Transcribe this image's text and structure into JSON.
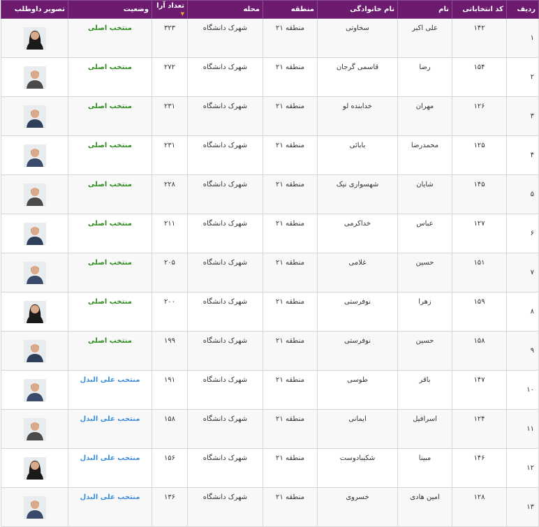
{
  "headers": {
    "row": "ردیف",
    "code": "کد انتخاباتی",
    "name": "نام",
    "family": "نام خانوادگی",
    "region": "منطقه",
    "area": "محله",
    "votes": "تعداد آرا",
    "status": "وضعیت",
    "photo": "تصویر داوطلب"
  },
  "colors": {
    "header_bg": "#6c1b6f",
    "status_main": "#2e8b1f",
    "status_alt": "#3b8fd8",
    "sort_icon": "#f0a33a"
  },
  "rows": [
    {
      "row": "۱",
      "code": "۱۴۲",
      "name": "علی اکبر",
      "family": "سخاوتی",
      "region": "منطقه ۲۱",
      "area": "شهرک دانشگاه",
      "votes": "۳۲۳",
      "status": "منتخب اصلی",
      "status_type": "main",
      "photo": "female-avatar-icon"
    },
    {
      "row": "۲",
      "code": "۱۵۴",
      "name": "رضا",
      "family": "قاسمی گرجان",
      "region": "منطقه ۲۱",
      "area": "شهرک دانشگاه",
      "votes": "۲۷۲",
      "status": "منتخب اصلی",
      "status_type": "main",
      "photo": "male-avatar-icon"
    },
    {
      "row": "۳",
      "code": "۱۲۶",
      "name": "مهران",
      "family": "خدابنده لو",
      "region": "منطقه ۲۱",
      "area": "شهرک دانشگاه",
      "votes": "۲۳۱",
      "status": "منتخب اصلی",
      "status_type": "main",
      "photo": "male-avatar-icon"
    },
    {
      "row": "۴",
      "code": "۱۲۵",
      "name": "محمدرضا",
      "family": "بابائی",
      "region": "منطقه ۲۱",
      "area": "شهرک دانشگاه",
      "votes": "۲۳۱",
      "status": "منتخب اصلی",
      "status_type": "main",
      "photo": "male-avatar-icon"
    },
    {
      "row": "۵",
      "code": "۱۴۵",
      "name": "شایان",
      "family": "شهسواری نیک",
      "region": "منطقه ۲۱",
      "area": "شهرک دانشگاه",
      "votes": "۲۲۸",
      "status": "منتخب اصلی",
      "status_type": "main",
      "photo": "male-avatar-icon"
    },
    {
      "row": "۶",
      "code": "۱۲۷",
      "name": "عباس",
      "family": "خداکرمی",
      "region": "منطقه ۲۱",
      "area": "شهرک دانشگاه",
      "votes": "۲۱۱",
      "status": "منتخب اصلی",
      "status_type": "main",
      "photo": "male-avatar-icon"
    },
    {
      "row": "۷",
      "code": "۱۵۱",
      "name": "حسین",
      "family": "غلامی",
      "region": "منطقه ۲۱",
      "area": "شهرک دانشگاه",
      "votes": "۲۰۵",
      "status": "منتخب اصلی",
      "status_type": "main",
      "photo": "male-avatar-icon"
    },
    {
      "row": "۸",
      "code": "۱۵۹",
      "name": "زهرا",
      "family": "نوفرستی",
      "region": "منطقه ۲۱",
      "area": "شهرک دانشگاه",
      "votes": "۲۰۰",
      "status": "منتخب اصلی",
      "status_type": "main",
      "photo": "female-avatar-icon"
    },
    {
      "row": "۹",
      "code": "۱۵۸",
      "name": "حسین",
      "family": "نوفرستی",
      "region": "منطقه ۲۱",
      "area": "شهرک دانشگاه",
      "votes": "۱۹۹",
      "status": "منتخب اصلی",
      "status_type": "main",
      "photo": "male-avatar-icon"
    },
    {
      "row": "۱۰",
      "code": "۱۴۷",
      "name": "باقر",
      "family": "طوسی",
      "region": "منطقه ۲۱",
      "area": "شهرک دانشگاه",
      "votes": "۱۹۱",
      "status": "منتخب علی البدل",
      "status_type": "alt",
      "photo": "male-avatar-icon"
    },
    {
      "row": "۱۱",
      "code": "۱۲۴",
      "name": "اسرافیل",
      "family": "ایمانی",
      "region": "منطقه ۲۱",
      "area": "شهرک دانشگاه",
      "votes": "۱۵۸",
      "status": "منتخب علی البدل",
      "status_type": "alt",
      "photo": "male-avatar-icon"
    },
    {
      "row": "۱۲",
      "code": "۱۴۶",
      "name": "مبینا",
      "family": "شکیبادوست",
      "region": "منطقه ۲۱",
      "area": "شهرک دانشگاه",
      "votes": "۱۵۶",
      "status": "منتخب علی البدل",
      "status_type": "alt",
      "photo": "female-avatar-icon"
    },
    {
      "row": "۱۳",
      "code": "۱۲۸",
      "name": "امین هادی",
      "family": "خسروی",
      "region": "منطقه ۲۱",
      "area": "شهرک دانشگاه",
      "votes": "۱۳۶",
      "status": "منتخب علی البدل",
      "status_type": "alt",
      "photo": "male-avatar-icon"
    }
  ]
}
